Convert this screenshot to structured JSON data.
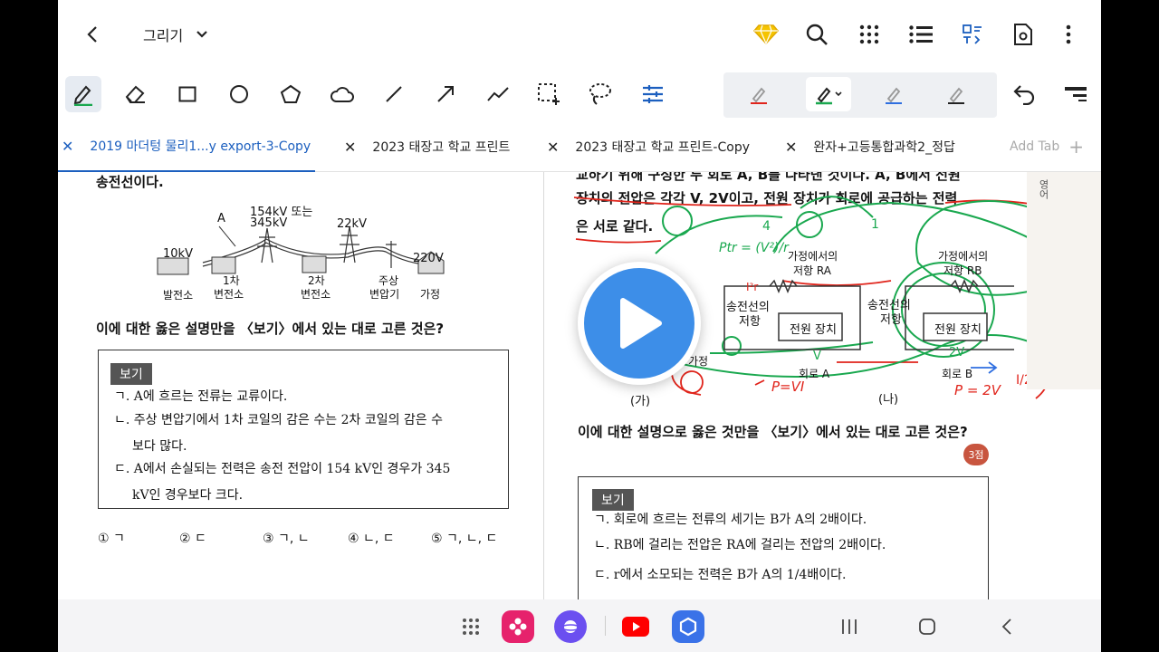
{
  "header": {
    "mode_title": "그리기"
  },
  "tabs": [
    {
      "label": "2019 마더텅 물리1...y export-3-Copy",
      "active": true
    },
    {
      "label": "2023 태장고 학교 프린트",
      "active": false
    },
    {
      "label": "2023 태장고 학교 프린트-Copy",
      "active": false
    },
    {
      "label": "완자+고등통합과학2_정답",
      "active": false
    }
  ],
  "add_tab_label": "Add Tab",
  "left_page": {
    "top_text": "송전선이다.",
    "diagram": {
      "label_a": "A",
      "label_154": "154kV 또는",
      "label_345": "345kV",
      "label_22": "22kV",
      "label_10": "10kV",
      "label_220": "220V",
      "plant": "발전소",
      "sub1_a": "1차",
      "sub1_b": "변전소",
      "sub2_a": "2차",
      "sub2_b": "변전소",
      "pole_a": "주상",
      "pole_b": "변압기",
      "home": "가정"
    },
    "question": "이에 대한 옳은 설명만을 〈보기〉에서 있는 대로 고른 것은?",
    "bogi_label": "보기",
    "items": [
      "ㄱ. A에 흐르는 전류는 교류이다.",
      "ㄴ. 주상 변압기에서 1차 코일의 감은 수는 2차 코일의 감은 수",
      "보다 많다.",
      "ㄷ. A에서 손실되는 전력은 송전 전압이 154 kV인 경우가 345",
      "kV인 경우보다 크다."
    ],
    "choices": [
      "① ㄱ",
      "② ㄷ",
      "③ ㄱ, ㄴ",
      "④ ㄴ, ㄷ",
      "⑤ ㄱ, ㄴ, ㄷ"
    ]
  },
  "right_page": {
    "line1": "교하기 위해 구성한 두 회로 A, B를 나타낸 것이다. A, B에서 전원",
    "line2": "장치의 전압은 각각 V, 2V이고, 전원 장치가 회로에 공급하는 전력",
    "line3": "은 서로 같다.",
    "fig_ga": "(가)",
    "fig_na": "(나)",
    "home": "가정",
    "res_home_a": "가정에서의",
    "res_home_a2": "저항 RA",
    "res_home_b": "가정에서의",
    "res_home_b2": "저항 RB",
    "line_res": "송전선의",
    "line_res2": "저항",
    "power_a": "전원 장치",
    "power_b": "전원 장치",
    "circuit_a": "회로 A",
    "circuit_b": "회로 B",
    "question": "이에 대한 설명으로 옳은 것만을 〈보기〉에서 있는 대로 고른 것은?",
    "points": "3점",
    "bogi_label": "보기",
    "items": [
      "ㄱ. 회로에 흐르는 전류의 세기는 B가 A의 2배이다.",
      "ㄴ. RB에 걸리는 전압은 RA에 걸리는 전압의 2배이다.",
      "ㄷ. r에서 소모되는 전력은 B가 A의 1/4배이다."
    ],
    "margin_label": "영어"
  },
  "handwriting": {
    "p_vi": "P=VI",
    "p_2v": "P = 2V",
    "i_half": "I/2",
    "two_v": "2V",
    "v": "V",
    "i2r": "I²r",
    "ptr": "Ptr = (V²)/r",
    "one": "1",
    "four": "4"
  },
  "colors": {
    "accent": "#1c5fbf",
    "play": "#3d8ee8",
    "green_ink": "#1aa84f",
    "red_ink": "#e0241b"
  }
}
